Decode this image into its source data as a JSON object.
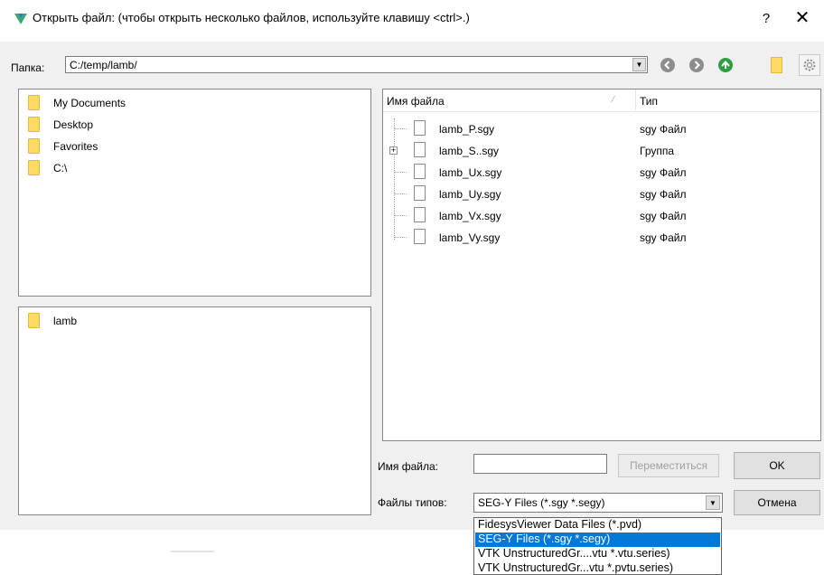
{
  "window": {
    "title": "Открыть файл:  (чтобы открыть несколько файлов, используйте клавишу <ctrl>.)",
    "help_label": "?",
    "close_label": "✕"
  },
  "folder_bar": {
    "label": "Папка:",
    "path": "C:/temp/lamb/",
    "dropdown_arrow": "▼"
  },
  "nav_icons": [
    "back-icon",
    "forward-icon",
    "up-folder-icon",
    "new-folder-icon",
    "settings-icon"
  ],
  "favorites": [
    {
      "label": "My Documents"
    },
    {
      "label": "Desktop"
    },
    {
      "label": "Favorites"
    },
    {
      "label": "C:\\"
    }
  ],
  "recent": [
    {
      "label": "lamb"
    }
  ],
  "file_list": {
    "columns": {
      "name": "Имя файла",
      "type": "Тип"
    },
    "rows": [
      {
        "name": "lamb_P.sgy",
        "type": "sgy Файл",
        "expandable": false
      },
      {
        "name": "lamb_S..sgy",
        "type": "Группа",
        "expandable": true
      },
      {
        "name": "lamb_Ux.sgy",
        "type": "sgy Файл",
        "expandable": false
      },
      {
        "name": "lamb_Uy.sgy",
        "type": "sgy Файл",
        "expandable": false
      },
      {
        "name": "lamb_Vx.sgy",
        "type": "sgy Файл",
        "expandable": false
      },
      {
        "name": "lamb_Vy.sgy",
        "type": "sgy Файл",
        "expandable": false
      }
    ]
  },
  "filename": {
    "label": "Имя файла:",
    "value": "",
    "move_button": "Переместиться",
    "ok_button": "OK"
  },
  "filetype": {
    "label": "Файлы типов:",
    "selected": "SEG-Y Files (*.sgy *.segy)",
    "cancel_button": "Отмена",
    "options": [
      "FidesysViewer Data Files (*.pvd)",
      "SEG-Y Files (*.sgy *.segy)",
      "VTK UnstructuredGr....vtu *.vtu.series)",
      "VTK UnstructuredGr...vtu *.pvtu.series)"
    ],
    "selected_index": 1
  },
  "colors": {
    "selection": "#0078d7",
    "nav_green": "#2e9e3e",
    "nav_gray": "#8c8c8c",
    "folder_yellow": "#ffd966"
  }
}
